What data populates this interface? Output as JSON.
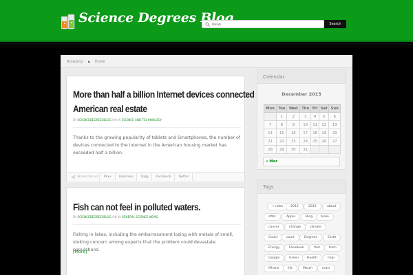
{
  "header": {
    "site_title": "Science Degrees Blog",
    "search_placeholder": "News",
    "search_button": "Search"
  },
  "breadcrumb": {
    "label": "Browsing:",
    "home": "Home"
  },
  "posts": [
    {
      "title_line1": "More than half a billion Internet devices connected in",
      "title_line2": "American real estate",
      "meta_by": "BY",
      "author": "SCIENCEDEGREESBLOG",
      "meta_in": "ON IN",
      "category": "SCIENCE AND TECHNOLOGY",
      "body": "Thanks to the growing popularity of tablets and Smartphones, the number of devices connected to the Internet in the American housing market has exceeded half a billion.",
      "share_label": "Share this on:",
      "share_links": [
        "Mixx",
        "Delicious",
        "Digg",
        "Facebook",
        "Twitter"
      ]
    },
    {
      "title": "Fish can not feel in polluted waters.",
      "meta_by": "BY",
      "author": "SCIENCEDEGREESBLOG",
      "meta_in": "ON IN",
      "category": "GENERAL SCIENCE NEWS",
      "body": "Fishing in lakes, including the embarrassment losing with metals of smell, stoking concern among experts that the problem could devastate populations.",
      "read_more": "[More]"
    }
  ],
  "sidebar": {
    "calendar": {
      "widget_title": "Calendar",
      "month_title": "December 2015",
      "days": [
        "Mon",
        "Tue",
        "Wed",
        "Thu",
        "Fri",
        "Sat",
        "Sun"
      ],
      "weeks": [
        [
          "",
          "1",
          "2",
          "3",
          "4",
          "5",
          "6"
        ],
        [
          "7",
          "8",
          "9",
          "10",
          "11",
          "12",
          "13"
        ],
        [
          "14",
          "15",
          "16",
          "17",
          "18",
          "19",
          "20"
        ],
        [
          "21",
          "22",
          "23",
          "24",
          "25",
          "26",
          "27"
        ],
        [
          "28",
          "29",
          "30",
          "31",
          "",
          "",
          ""
        ]
      ],
      "prev_link": "« Mar"
    },
    "tags": {
      "widget_title": "Tags",
      "items": [
        "+video",
        "2012",
        "2013",
        "about",
        "after",
        "Apple",
        "Blog",
        "brain",
        "cancer",
        "change",
        "climate",
        "Could",
        "court",
        "Degrees",
        "Earth",
        "Energy",
        "Facebook",
        "first",
        "from",
        "Google",
        "Green",
        "Health",
        "help",
        "iPhone",
        "life",
        "March",
        "mars"
      ]
    }
  },
  "colors": {
    "header_green": "#0c9a19",
    "link_green": "#0a8a18",
    "page_background": "#000000"
  }
}
